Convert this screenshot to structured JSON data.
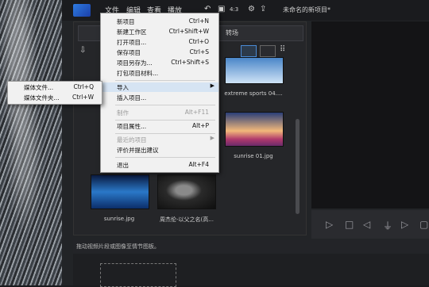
{
  "menubar": [
    "文件",
    "编辑",
    "查看",
    "播放"
  ],
  "document_title": "未命名的新项目*",
  "toolbar_icons": [
    "aspect-ratio-icon",
    "undo-icon",
    "redo-icon",
    "display-ratio-icon",
    "settings-icon",
    "upload-icon"
  ],
  "toolbar_text": {
    "ratio": "4:3"
  },
  "library": {
    "tab_label": "转场",
    "view_icons": [
      "list-view-icon",
      "thumbnail-view-icon",
      "grid-view-icon"
    ],
    "items": [
      {
        "caption": "extreme sports 04....",
        "icon": "skydiver-thumbnail"
      },
      {
        "caption": "sunrise 01.jpg",
        "icon": "sunrise-flowers-thumbnail"
      },
      {
        "caption": "sunrise.jpg",
        "icon": "sunrise-lake-thumbnail"
      },
      {
        "caption": "周杰伦-以父之名(高...",
        "icon": "music-video-thumbnail"
      }
    ]
  },
  "file_menu": {
    "items": [
      {
        "label": "新项目",
        "shortcut": "Ctrl+N",
        "disabled": false
      },
      {
        "label": "新建工作区",
        "shortcut": "Ctrl+Shift+W",
        "disabled": false
      },
      {
        "label": "打开项目...",
        "shortcut": "Ctrl+O",
        "disabled": false
      },
      {
        "label": "保存项目",
        "shortcut": "Ctrl+S",
        "disabled": false
      },
      {
        "label": "项目另存为...",
        "shortcut": "Ctrl+Shift+S",
        "disabled": false
      },
      {
        "label": "打包项目材料...",
        "shortcut": "",
        "disabled": false
      },
      {
        "label": "导入",
        "shortcut": "",
        "disabled": false,
        "submenu": true,
        "highlighted": true
      },
      {
        "label": "插入项目...",
        "shortcut": "",
        "disabled": false
      },
      {
        "label": "制作",
        "shortcut": "Alt+F11",
        "disabled": true
      },
      {
        "label": "项目属性...",
        "shortcut": "Alt+P",
        "disabled": false
      },
      {
        "label": "最近的项目",
        "shortcut": "",
        "disabled": true,
        "submenu": true
      },
      {
        "label": "评价并提出建议",
        "shortcut": "",
        "disabled": false
      },
      {
        "label": "退出",
        "shortcut": "Alt+F4",
        "disabled": false
      }
    ]
  },
  "import_submenu": [
    {
      "label": "媒体文件...",
      "shortcut": "Ctrl+Q"
    },
    {
      "label": "媒体文件夹...",
      "shortcut": "Ctrl+W"
    }
  ],
  "status_bar": "拖动视频片段或图像至情节图板。",
  "preview_controls": [
    "play-icon",
    "stop-icon",
    "prev-frame-icon",
    "split-icon",
    "next-frame-icon",
    "fullscreen-icon"
  ]
}
